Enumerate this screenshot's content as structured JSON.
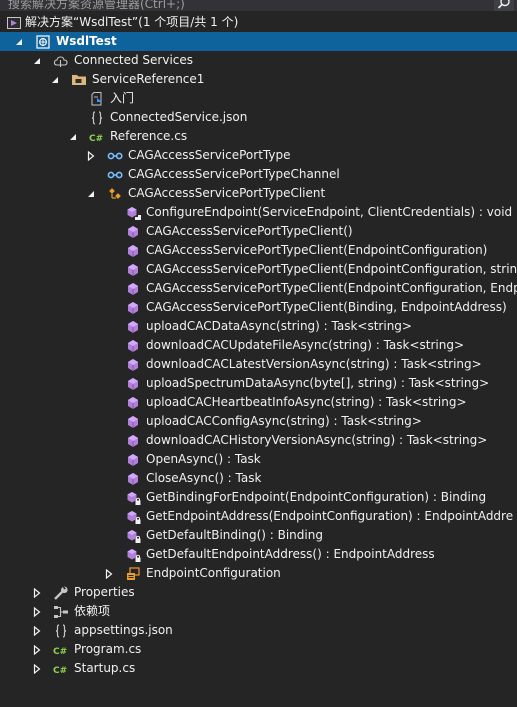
{
  "search": {
    "text": "搜索解决方案资源管理器(Ctrl+;)"
  },
  "tree": [
    {
      "label": "解决方案“WsdlTest”(1 个项目/共 1 个)",
      "icon": "solution-icon",
      "arrow": "none"
    },
    {
      "label": "WsdlTest",
      "icon": "project-icon",
      "arrow": "expanded",
      "selected": true
    },
    {
      "label": "Connected Services",
      "icon": "connected-services-icon",
      "arrow": "expanded"
    },
    {
      "label": "ServiceReference1",
      "icon": "folder-icon",
      "arrow": "expanded"
    },
    {
      "label": "入门",
      "icon": "getting-started-icon",
      "arrow": "none"
    },
    {
      "label": "ConnectedService.json",
      "icon": "json-file-icon",
      "arrow": "none"
    },
    {
      "label": "Reference.cs",
      "icon": "csharp-file-icon",
      "arrow": "expanded"
    },
    {
      "label": "CAGAccessServicePortType",
      "icon": "interface-icon",
      "arrow": "collapsed"
    },
    {
      "label": "CAGAccessServicePortTypeChannel",
      "icon": "interface-icon",
      "arrow": "none"
    },
    {
      "label": "CAGAccessServicePortTypeClient",
      "icon": "class-icon",
      "arrow": "expanded"
    },
    {
      "label": "ConfigureEndpoint(ServiceEndpoint, ClientCredentials) : void",
      "icon": "protected-method-icon",
      "arrow": "none"
    },
    {
      "label": "CAGAccessServicePortTypeClient()",
      "icon": "method-icon",
      "arrow": "none"
    },
    {
      "label": "CAGAccessServicePortTypeClient(EndpointConfiguration)",
      "icon": "method-icon",
      "arrow": "none"
    },
    {
      "label": "CAGAccessServicePortTypeClient(EndpointConfiguration, string",
      "icon": "method-icon",
      "arrow": "none"
    },
    {
      "label": "CAGAccessServicePortTypeClient(EndpointConfiguration, Endp",
      "icon": "method-icon",
      "arrow": "none"
    },
    {
      "label": "CAGAccessServicePortTypeClient(Binding, EndpointAddress)",
      "icon": "method-icon",
      "arrow": "none"
    },
    {
      "label": "uploadCACDataAsync(string) : Task<string>",
      "icon": "method-icon",
      "arrow": "none"
    },
    {
      "label": "downloadCACUpdateFileAsync(string) : Task<string>",
      "icon": "method-icon",
      "arrow": "none"
    },
    {
      "label": "downloadCACLatestVersionAsync(string) : Task<string>",
      "icon": "method-icon",
      "arrow": "none"
    },
    {
      "label": "uploadSpectrumDataAsync(byte[], string) : Task<string>",
      "icon": "method-icon",
      "arrow": "none"
    },
    {
      "label": "uploadCACHeartbeatInfoAsync(string) : Task<string>",
      "icon": "method-icon",
      "arrow": "none"
    },
    {
      "label": "uploadCACConfigAsync(string) : Task<string>",
      "icon": "method-icon",
      "arrow": "none"
    },
    {
      "label": "downloadCACHistoryVersionAsync(string) : Task<string>",
      "icon": "method-icon",
      "arrow": "none"
    },
    {
      "label": "OpenAsync() : Task",
      "icon": "method-icon",
      "arrow": "none"
    },
    {
      "label": "CloseAsync() : Task",
      "icon": "method-icon",
      "arrow": "none"
    },
    {
      "label": "GetBindingForEndpoint(EndpointConfiguration) : Binding",
      "icon": "private-method-icon",
      "arrow": "none"
    },
    {
      "label": "GetEndpointAddress(EndpointConfiguration) : EndpointAddre",
      "icon": "private-method-icon",
      "arrow": "none"
    },
    {
      "label": "GetDefaultBinding() : Binding",
      "icon": "private-method-icon",
      "arrow": "none"
    },
    {
      "label": "GetDefaultEndpointAddress() : EndpointAddress",
      "icon": "private-method-icon",
      "arrow": "none"
    },
    {
      "label": "EndpointConfiguration",
      "icon": "enum-icon",
      "arrow": "collapsed"
    },
    {
      "label": "Properties",
      "icon": "wrench-icon",
      "arrow": "collapsed"
    },
    {
      "label": "依赖项",
      "icon": "dependencies-icon",
      "arrow": "collapsed"
    },
    {
      "label": "appsettings.json",
      "icon": "json-file-icon",
      "arrow": "collapsed"
    },
    {
      "label": "Program.cs",
      "icon": "csharp-file-icon",
      "arrow": "collapsed"
    },
    {
      "label": "Startup.cs",
      "icon": "csharp-file-icon",
      "arrow": "collapsed"
    }
  ]
}
